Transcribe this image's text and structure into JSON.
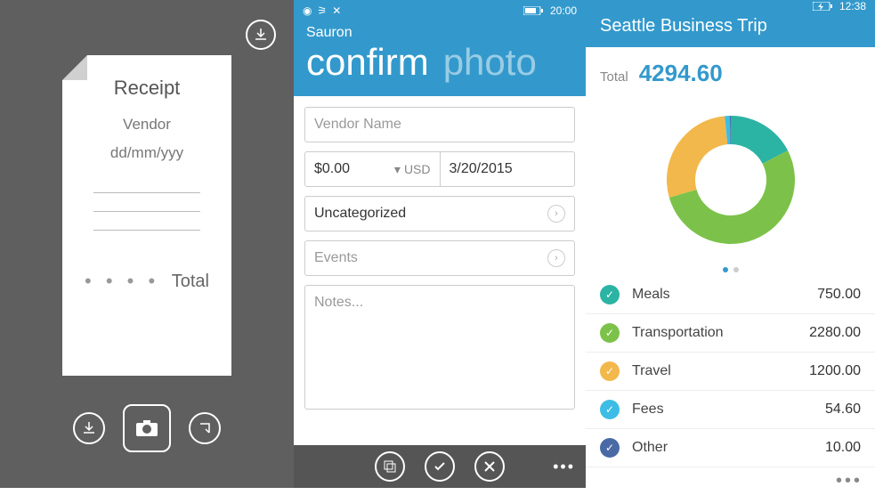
{
  "panel1": {
    "receipt_title": "Receipt",
    "vendor_placeholder": "Vendor",
    "date_placeholder": "dd/mm/yyy",
    "dots": "• • • •",
    "total_label": "Total"
  },
  "panel2": {
    "status_time": "20:00",
    "app_name": "Sauron",
    "tab_active": "confirm",
    "tab_inactive": "photo",
    "vendor_placeholder": "Vendor Name",
    "amount_value": "$0.00",
    "currency": "USD",
    "date_value": "3/20/2015",
    "category_label": "Uncategorized",
    "events_label": "Events",
    "notes_placeholder": "Notes..."
  },
  "panel3": {
    "status_time": "12:38",
    "trip_title": "Seattle Business Trip",
    "total_label": "Total",
    "total_value": "4294.60",
    "categories": [
      {
        "label": "Meals",
        "amount": "750.00",
        "color": "#2bb3a3"
      },
      {
        "label": "Transportation",
        "amount": "2280.00",
        "color": "#7cc24a"
      },
      {
        "label": "Travel",
        "amount": "1200.00",
        "color": "#f2b84b"
      },
      {
        "label": "Fees",
        "amount": "54.60",
        "color": "#3dbde5"
      },
      {
        "label": "Other",
        "amount": "10.00",
        "color": "#4a6aa5"
      }
    ]
  },
  "chart_data": {
    "type": "pie",
    "title": "Seattle Business Trip expense breakdown",
    "series": [
      {
        "name": "Meals",
        "value": 750.0,
        "color": "#2bb3a3"
      },
      {
        "name": "Transportation",
        "value": 2280.0,
        "color": "#7cc24a"
      },
      {
        "name": "Travel",
        "value": 1200.0,
        "color": "#f2b84b"
      },
      {
        "name": "Fees",
        "value": 54.6,
        "color": "#3dbde5"
      },
      {
        "name": "Other",
        "value": 10.0,
        "color": "#4a6aa5"
      }
    ],
    "total": 4294.6
  }
}
